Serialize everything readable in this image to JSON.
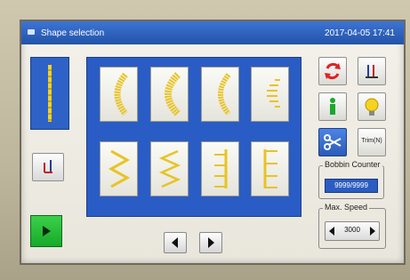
{
  "titlebar": {
    "title": "Shape selection",
    "datetime": "2017-04-05  17:41"
  },
  "shapes": [
    {
      "name": "shape-tile-arc-1",
      "icon": "arc-stitch-icon"
    },
    {
      "name": "shape-tile-arc-2",
      "icon": "arc-stitch-icon"
    },
    {
      "name": "shape-tile-arc-3",
      "icon": "arc-stitch-icon"
    },
    {
      "name": "shape-tile-arc-4",
      "icon": "half-arc-stitch-icon"
    },
    {
      "name": "shape-tile-zigzag-1",
      "icon": "zigzag-stitch-icon"
    },
    {
      "name": "shape-tile-zigzag-2",
      "icon": "zigzag-stitch-icon"
    },
    {
      "name": "shape-tile-comb-1",
      "icon": "comb-stitch-icon"
    },
    {
      "name": "shape-tile-comb-2",
      "icon": "comb-stitch-icon"
    }
  ],
  "right_panel": {
    "trim_label": "Trim(N)",
    "bobbin_counter": {
      "label": "Bobbin Counter",
      "value": "9999/9999"
    },
    "max_speed": {
      "label": "Max. Speed",
      "value": "3000"
    }
  },
  "colors": {
    "accent_blue": "#2a5cc5",
    "stitch_yellow": "#f1d22e",
    "start_green": "#2fbf3c"
  }
}
